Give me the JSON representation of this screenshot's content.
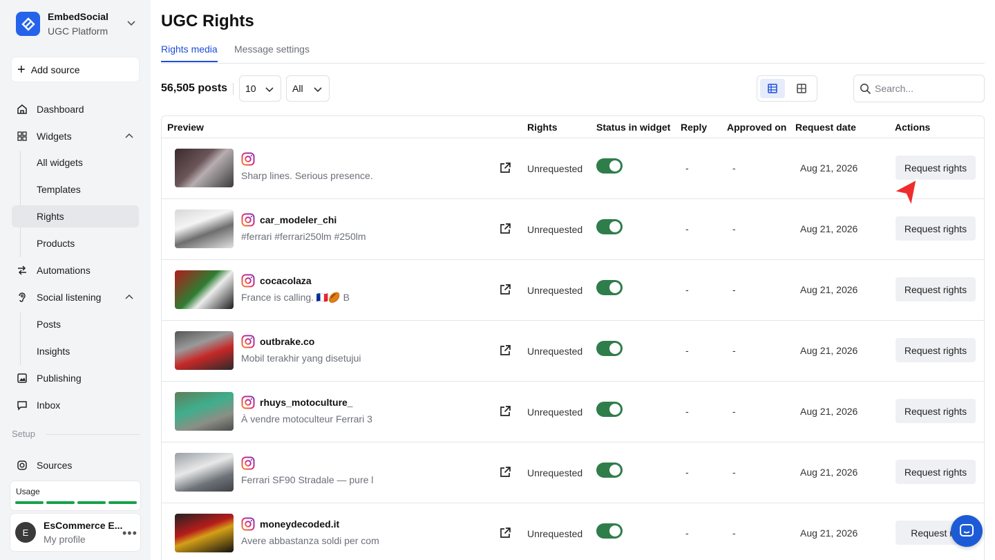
{
  "colors": {
    "accent": "#1d4ed8",
    "brand": "#2563eb",
    "toggle_on": "#2f7d4b",
    "usage_bar": "#16a34a"
  },
  "brand": {
    "name": "EmbedSocial",
    "subtitle": "UGC Platform"
  },
  "sidebar": {
    "add_source": "Add source",
    "dashboard": "Dashboard",
    "widgets": "Widgets",
    "all_widgets": "All widgets",
    "templates": "Templates",
    "rights": "Rights",
    "products": "Products",
    "automations": "Automations",
    "social_listening": "Social listening",
    "posts": "Posts",
    "insights": "Insights",
    "publishing": "Publishing",
    "inbox": "Inbox",
    "setup_label": "Setup",
    "sources": "Sources",
    "usage_label": "Usage",
    "usage_segments_filled": 4,
    "profile_initial": "E",
    "profile_name": "EsCommerce E...",
    "profile_sub": "My profile"
  },
  "page": {
    "title": "UGC Rights"
  },
  "tabs": [
    {
      "label": "Rights media",
      "active": true
    },
    {
      "label": "Message settings",
      "active": false
    }
  ],
  "toolbar": {
    "count": "56,505 posts",
    "page_size": "10",
    "filter": "All",
    "search_placeholder": "Search..."
  },
  "table": {
    "headers": {
      "preview": "Preview",
      "rights": "Rights",
      "status": "Status in widget",
      "reply": "Reply",
      "approved": "Approved on",
      "request_date": "Request date",
      "actions": "Actions"
    },
    "rows": [
      {
        "username": "",
        "caption": "Sharp lines. Serious presence.",
        "rights": "Unrequested",
        "status_on": true,
        "reply": "-",
        "approved": "-",
        "date": "Aug 21, 2026",
        "action": "Request rights"
      },
      {
        "username": "car_modeler_chi",
        "caption": "#ferrari #ferrari250lm #250lm",
        "rights": "Unrequested",
        "status_on": true,
        "reply": "-",
        "approved": "-",
        "date": "Aug 21, 2026",
        "action": "Request rights"
      },
      {
        "username": "cocacolaza",
        "caption": "France is calling. 🇫🇷🏉 B",
        "rights": "Unrequested",
        "status_on": true,
        "reply": "-",
        "approved": "-",
        "date": "Aug 21, 2026",
        "action": "Request rights"
      },
      {
        "username": "outbrake.co",
        "caption": "Mobil terakhir yang disetujui",
        "rights": "Unrequested",
        "status_on": true,
        "reply": "-",
        "approved": "-",
        "date": "Aug 21, 2026",
        "action": "Request rights"
      },
      {
        "username": "rhuys_motoculture_",
        "caption": "À vendre motoculteur Ferrari 3",
        "rights": "Unrequested",
        "status_on": true,
        "reply": "-",
        "approved": "-",
        "date": "Aug 21, 2026",
        "action": "Request rights"
      },
      {
        "username": "",
        "caption": "Ferrari SF90 Stradale — pure l",
        "rights": "Unrequested",
        "status_on": true,
        "reply": "-",
        "approved": "-",
        "date": "Aug 21, 2026",
        "action": "Request rights"
      },
      {
        "username": "moneydecoded.it",
        "caption": "Avere abbastanza soldi per com",
        "rights": "Unrequested",
        "status_on": true,
        "reply": "-",
        "approved": "-",
        "date": "Aug 21, 2026",
        "action": "Request rig"
      }
    ]
  },
  "icons": {
    "logo": "embedsocial-logo-icon",
    "chat": "chat-bubble-icon",
    "cursor": "pointer-cursor-icon"
  }
}
